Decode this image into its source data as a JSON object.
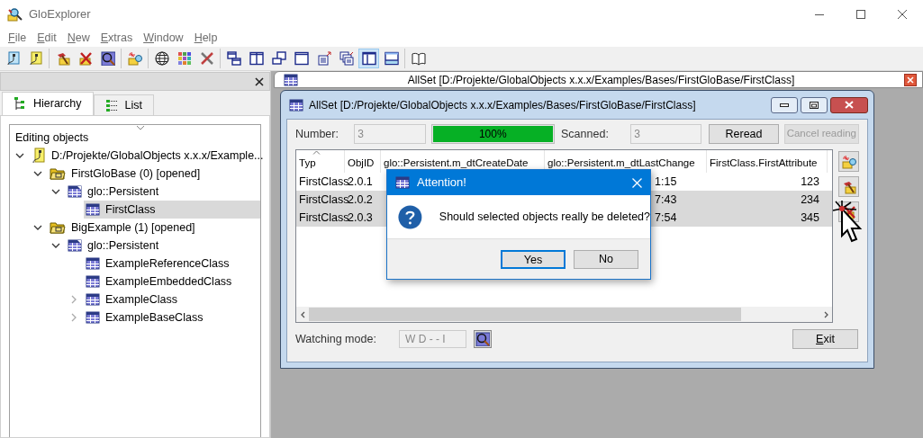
{
  "window": {
    "title": "GloExplorer"
  },
  "menu": [
    "File",
    "Edit",
    "New",
    "Extras",
    "Window",
    "Help"
  ],
  "toolbar": [
    {
      "buttons": [
        {
          "selected": false
        },
        {
          "selected": false
        }
      ]
    },
    {
      "buttons": [
        {
          "selected": false
        },
        {
          "selected": false
        },
        {
          "selected": false
        }
      ]
    },
    {
      "buttons": [
        {
          "selected": false
        }
      ]
    },
    {
      "buttons": [
        {
          "selected": false
        },
        {
          "selected": false
        },
        {
          "selected": false
        }
      ]
    },
    {
      "buttons": [
        {
          "selected": false
        },
        {
          "selected": false
        },
        {
          "selected": false
        },
        {
          "selected": false
        },
        {
          "selected": false
        },
        {
          "selected": false
        },
        {
          "selected": true
        },
        {
          "selected": false
        }
      ]
    },
    {
      "buttons": [
        {
          "selected": false
        }
      ]
    }
  ],
  "left_panel": {
    "tabs": [
      {
        "label": "Hierarchy",
        "selected": true
      },
      {
        "label": "List",
        "selected": false
      }
    ],
    "tree": {
      "heading": "Editing objects",
      "items": [
        {
          "label": "D:/Projekte/GlobalObjects x.x.x/Example...",
          "kind": "database",
          "expanded": true,
          "selected": false,
          "children": [
            {
              "label": "FirstGloBase (0) [opened]",
              "kind": "base",
              "expanded": true,
              "selected": false,
              "children": [
                {
                  "label": "glo::Persistent",
                  "kind": "package",
                  "expanded": true,
                  "selected": false,
                  "children": [
                    {
                      "label": "FirstClass",
                      "kind": "class",
                      "selected": true
                    }
                  ]
                }
              ]
            },
            {
              "label": "BigExample (1) [opened]",
              "kind": "base",
              "expanded": true,
              "selected": false,
              "children": [
                {
                  "label": "glo::Persistent",
                  "kind": "package",
                  "expanded": true,
                  "selected": false,
                  "children": [
                    {
                      "label": "ExampleReferenceClass",
                      "kind": "class",
                      "selected": false
                    },
                    {
                      "label": "ExampleEmbeddedClass",
                      "kind": "class",
                      "selected": false
                    },
                    {
                      "label": "ExampleClass",
                      "kind": "class",
                      "expanded": false,
                      "selected": false
                    },
                    {
                      "label": "ExampleBaseClass",
                      "kind": "class",
                      "expanded": false,
                      "selected": false
                    }
                  ]
                }
              ]
            }
          ]
        }
      ]
    }
  },
  "document_tab": {
    "title": "AllSet [D:/Projekte/GlobalObjects x.x.x/Examples/Bases/FirstGloBase/FirstClass]"
  },
  "child_window": {
    "title": "AllSet [D:/Projekte/GlobalObjects x.x.x/Examples/Bases/FirstGloBase/FirstClass]",
    "number_label": "Number:",
    "number": "3",
    "progress": {
      "level": 1,
      "text": "100%"
    },
    "scanned_label": "Scanned:",
    "scanned": "3",
    "buttons": [
      {
        "label": "Reread",
        "disabled": false
      },
      {
        "label": "Cancel reading",
        "disabled": true
      }
    ],
    "table": {
      "columns": [
        "Typ",
        "ObjID",
        "glo::Persistent.m_dtCreateDate",
        "glo::Persistent.m_dtLastChange",
        "FirstClass.FirstAttribute"
      ],
      "rows": [
        {
          "typ": "FirstClass",
          "objid": "2.0.1",
          "last_change": "1:15",
          "first_attribute": "123",
          "selected": false
        },
        {
          "typ": "FirstClass",
          "objid": "2.0.2",
          "last_change": "7:43",
          "first_attribute": "234",
          "selected": true
        },
        {
          "typ": "FirstClass",
          "objid": "2.0.3",
          "last_change": "7:54",
          "first_attribute": "345",
          "selected": true
        }
      ]
    },
    "watching_label": "Watching mode:",
    "watching_mode": "W D - - I",
    "exit": "Exit"
  },
  "dialog": {
    "title": "Attention!",
    "message": "Should selected objects really be deleted?",
    "buttons": [
      {
        "label": "Yes",
        "default": true
      },
      {
        "label": "No",
        "default": false
      }
    ]
  }
}
